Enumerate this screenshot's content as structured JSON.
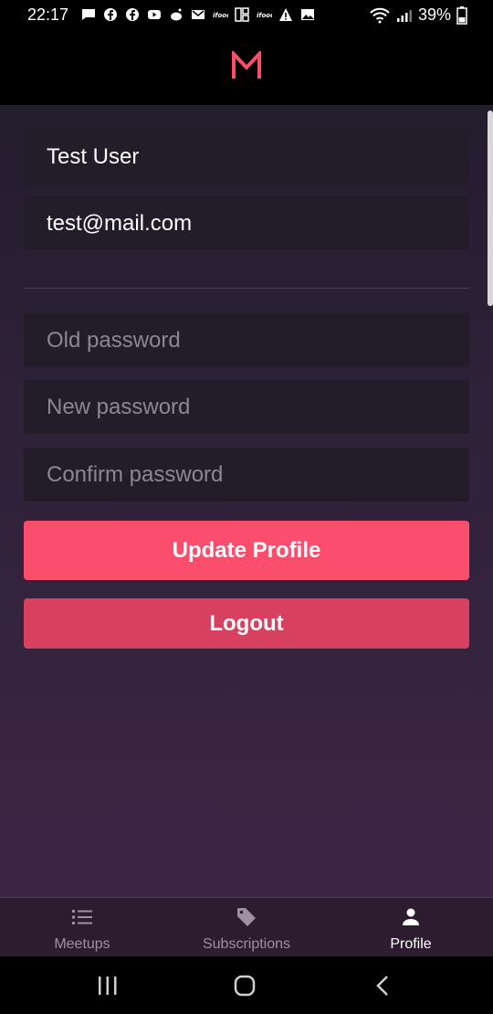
{
  "status_bar": {
    "time": "22:17",
    "battery": "39%",
    "notification_icons": [
      "message-icon",
      "facebook-icon",
      "facebook-icon",
      "youtube-icon",
      "reddit-icon",
      "gmail-icon",
      "ifood-icon",
      "layout-icon",
      "ifood-icon",
      "warning-icon",
      "image-icon"
    ]
  },
  "app": {
    "logo_letter": "M",
    "accent_color": "#fb4d6c"
  },
  "profile_form": {
    "name_value": "Test User",
    "email_value": "test@mail.com",
    "old_password_placeholder": "Old password",
    "new_password_placeholder": "New password",
    "confirm_password_placeholder": "Confirm password",
    "update_button": "Update Profile",
    "logout_button": "Logout"
  },
  "bottom_nav": {
    "items": [
      {
        "label": "Meetups",
        "icon": "list-icon",
        "active": false
      },
      {
        "label": "Subscriptions",
        "icon": "tag-icon",
        "active": false
      },
      {
        "label": "Profile",
        "icon": "person-icon",
        "active": true
      }
    ]
  }
}
